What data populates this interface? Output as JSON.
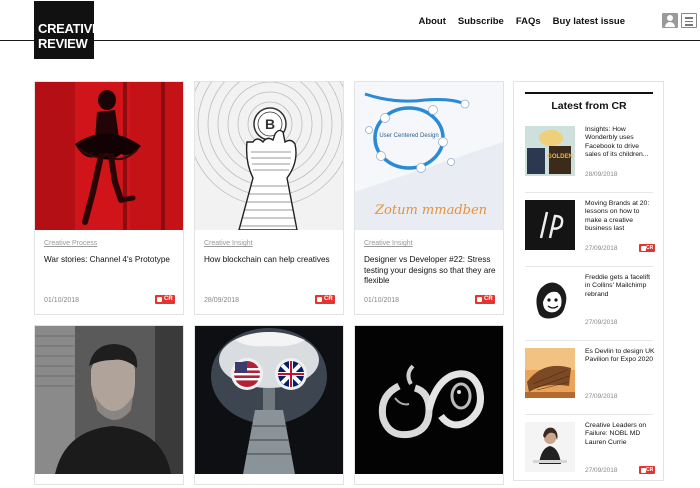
{
  "brand": {
    "line1": "CREATIVE",
    "line2": "REVIEW"
  },
  "nav": [
    {
      "label": "About"
    },
    {
      "label": "Subscribe"
    },
    {
      "label": "FAQs"
    },
    {
      "label": "Buy latest issue"
    }
  ],
  "icons": {
    "account": "user-icon",
    "menu": "hamburger-menu-icon",
    "lock": "lock-icon"
  },
  "colors": {
    "accent": "#e3342f",
    "header_border": "#1a1a1a",
    "category": "#9a9a9a"
  },
  "articles": [
    {
      "category": "Creative Process",
      "title": "War stories: Channel 4's Prototype",
      "date": "01/10/2018",
      "locked": true
    },
    {
      "category": "Creative Insight",
      "title": "How blockchain can help creatives",
      "date": "28/09/2018",
      "locked": true
    },
    {
      "category": "Creative Insight",
      "title": "Designer vs Developer #22: Stress testing your designs so that they are flexible",
      "date": "01/10/2018",
      "locked": true
    },
    {
      "category": "",
      "title": "",
      "date": "",
      "locked": false
    },
    {
      "category": "",
      "title": "",
      "date": "",
      "locked": false
    },
    {
      "category": "",
      "title": "",
      "date": "",
      "locked": false
    }
  ],
  "diagram": {
    "center_label": "User Centered Design",
    "handwriting": "Zotum mmadben"
  },
  "sidebar": {
    "title": "Latest from CR",
    "items": [
      {
        "title": "Insights: How Wonderbly uses Facebook to drive sales of its children...",
        "date": "28/09/2018",
        "locked": false,
        "thumb_text": "GOLDEN"
      },
      {
        "title": "Moving Brands at 20: lessons on how to make a creative business last",
        "date": "27/09/2018",
        "locked": true
      },
      {
        "title": "Freddie gets a facelift in Collins' Mailchimp rebrand",
        "date": "27/09/2018",
        "locked": false
      },
      {
        "title": "Es Devlin to design UK Pavilion for Expo 2020",
        "date": "27/09/2018",
        "locked": false
      },
      {
        "title": "Creative Leaders on Failure: NOBL MD Lauren Currie",
        "date": "27/09/2018",
        "locked": true
      }
    ]
  }
}
